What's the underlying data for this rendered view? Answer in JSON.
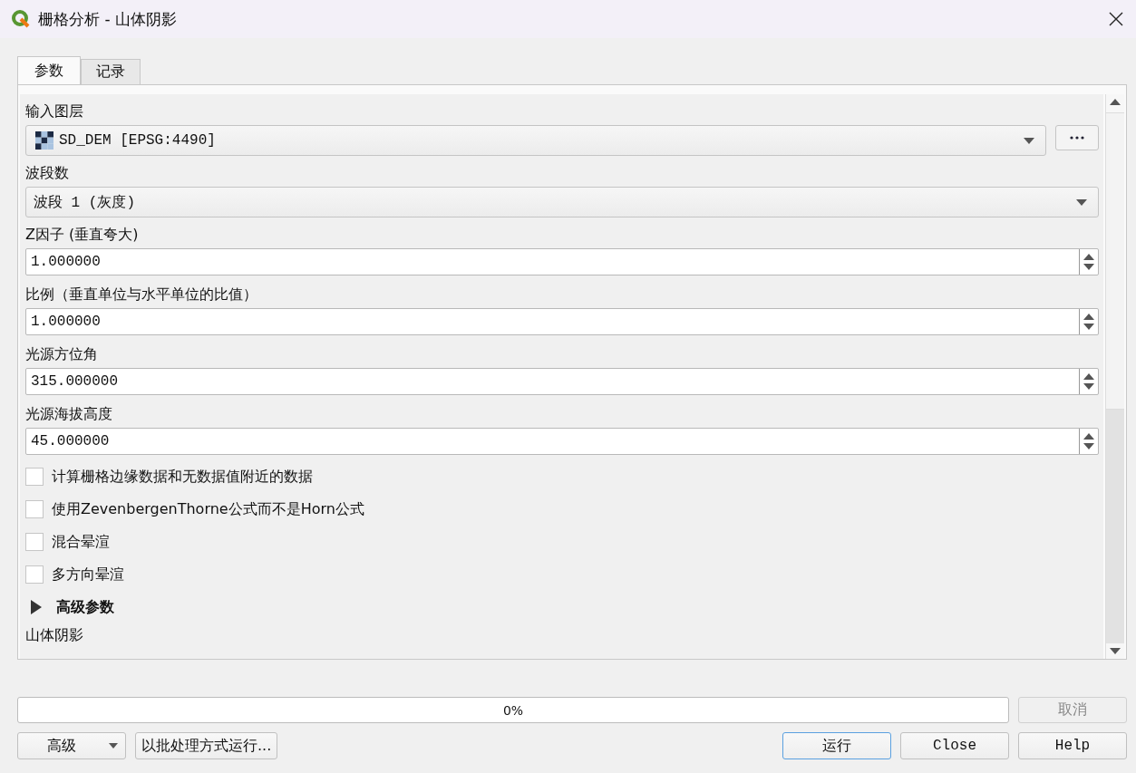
{
  "window": {
    "title": "栅格分析 - 山体阴影"
  },
  "tabs": [
    {
      "label": "参数",
      "selected": true
    },
    {
      "label": "记录",
      "selected": false
    }
  ],
  "fields": [
    {
      "kind": "layer",
      "label": "输入图层",
      "value": "SD_DEM [EPSG:4490]"
    },
    {
      "kind": "combo",
      "label": "波段数",
      "value": "波段 1 (灰度)"
    },
    {
      "kind": "spin",
      "label": "Z因子 (垂直夸大)",
      "value": "1.000000"
    },
    {
      "kind": "spin",
      "label": "比例（垂直单位与水平单位的比值）",
      "value": "1.000000"
    },
    {
      "kind": "spin",
      "label": "光源方位角",
      "value": "315.000000"
    },
    {
      "kind": "spin",
      "label": "光源海拔高度",
      "value": "45.000000"
    }
  ],
  "checkboxes": [
    {
      "label": "计算栅格边缘数据和无数据值附近的数据",
      "checked": false
    },
    {
      "label": "使用ZevenbergenThorne公式而不是Horn公式",
      "checked": false
    },
    {
      "label": "混合晕渲",
      "checked": false
    },
    {
      "label": "多方向晕渲",
      "checked": false
    }
  ],
  "advanced": {
    "label": "高级参数",
    "expanded": false
  },
  "next_label": "山体阴影",
  "progress": {
    "level": 0,
    "text": "0%"
  },
  "buttons": {
    "cancel": {
      "label": "取消",
      "disabled": true
    },
    "advanced": "高级",
    "batch": "以批处理方式运行...",
    "run": "运行",
    "close": "Close",
    "help": "Help"
  }
}
